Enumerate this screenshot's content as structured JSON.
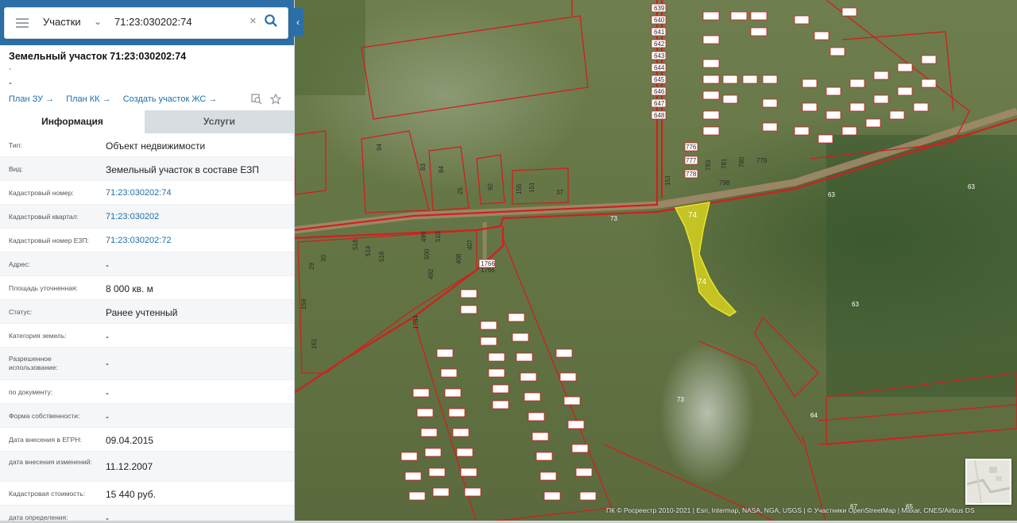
{
  "search": {
    "type_label": "Участки",
    "query": "71:23:030202:74"
  },
  "parcel": {
    "title": "Земельный участок 71:23:030202:74",
    "line1": "-",
    "line2": "-"
  },
  "links": {
    "plan_zu": "План ЗУ →",
    "plan_kk": "План КК →",
    "create_zhs": "Создать участок ЖС →"
  },
  "tabs": {
    "info": "Информация",
    "services": "Услуги"
  },
  "details": [
    {
      "key": "Тип:",
      "value": "Объект недвижимости"
    },
    {
      "key": "Вид:",
      "value": "Земельный участок в составе ЕЗП"
    },
    {
      "key": "Кадастровый номер:",
      "value": "71:23:030202:74",
      "link": true
    },
    {
      "key": "Кадастровый квартал:",
      "value": "71:23:030202",
      "link": true
    },
    {
      "key": "Кадастровый номер ЕЗП:",
      "value": "71:23:030202:72",
      "link": true
    },
    {
      "key": "Адрес:",
      "value": "-"
    },
    {
      "key": "Площадь уточненная:",
      "value": "8 000 кв. м"
    },
    {
      "key": "Статус:",
      "value": "Ранее учтенный"
    },
    {
      "key": "Категория земель:",
      "value": "-"
    },
    {
      "key": "Разрешенное использование:",
      "value": "-"
    },
    {
      "key": "по документу:",
      "value": "-"
    },
    {
      "key": "Форма собственности:",
      "value": "-"
    },
    {
      "key": "Дата внесения в ЕГРН:",
      "value": "09.04.2015"
    },
    {
      "key": "дата внесения изменений:",
      "value": "11.12.2007"
    },
    {
      "key": "Кадастровая стоимость:",
      "value": "15 440 руб."
    },
    {
      "key": "дата определения:",
      "value": "-"
    }
  ],
  "map": {
    "selected_label_top": "74",
    "selected_label_bottom": "74",
    "labels": [
      "73",
      "73",
      "63",
      "63",
      "63",
      "64",
      "67",
      "65",
      "151",
      "798",
      "776",
      "777",
      "778",
      "783",
      "781",
      "780",
      "779",
      "92",
      "94",
      "83",
      "84",
      "25",
      "37",
      "151",
      "155",
      "1764",
      "1765",
      "1766",
      "407",
      "408",
      "492",
      "499",
      "500",
      "510",
      "514",
      "516",
      "518",
      "29",
      "30",
      "159",
      "161",
      "639",
      "640",
      "641",
      "642",
      "643",
      "644",
      "645",
      "646",
      "647",
      "648"
    ],
    "attribution": "ПК © Росреестр 2010-2021 | Esri, Intermap, NASA, NGA, USGS | © Участники OpenStreetMap | Maxar, CNES/Airbus DS",
    "colors": {
      "boundary": "#d11f1f",
      "selected_fill": "#d6d21e",
      "selected_stroke": "#e9e62a"
    }
  }
}
